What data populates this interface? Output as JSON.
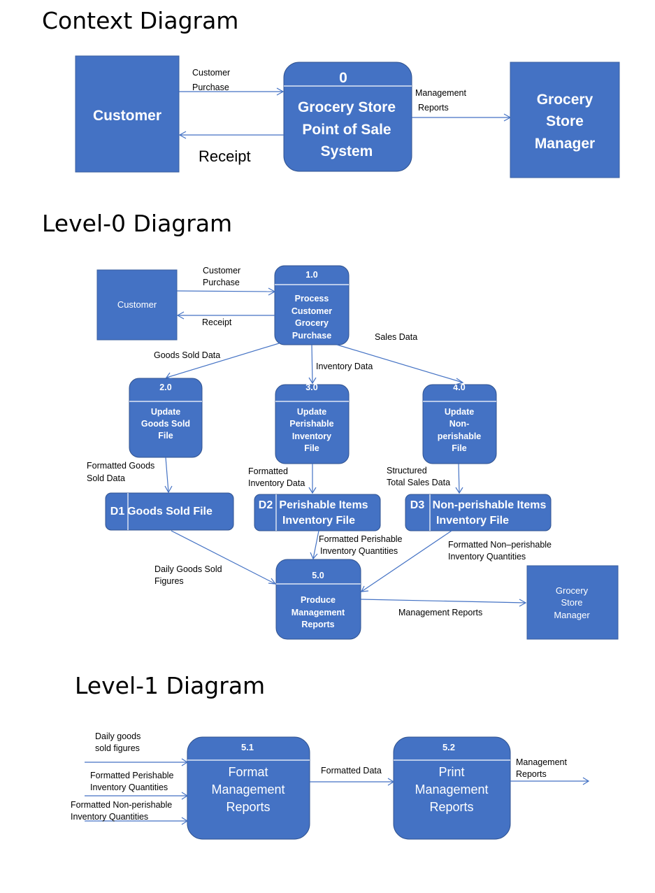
{
  "context": {
    "title": "Context Diagram",
    "customer": "Customer",
    "process_id": "0",
    "process_lines": [
      "Grocery Store",
      "Point of Sale",
      "System"
    ],
    "manager_lines": [
      "Grocery",
      "Store",
      "Manager"
    ],
    "flows": {
      "customer_purchase": [
        "Customer",
        "Purchase"
      ],
      "receipt": "Receipt",
      "management_reports": [
        "Management",
        "Reports"
      ]
    }
  },
  "level0": {
    "title": "Level-0 Diagram",
    "customer": "Customer",
    "manager_lines": [
      "Grocery",
      "Store",
      "Manager"
    ],
    "processes": [
      {
        "id": "1.0",
        "lines": [
          "Process",
          "Customer",
          "Grocery",
          "Purchase"
        ]
      },
      {
        "id": "2.0",
        "lines": [
          "Update",
          "Goods Sold",
          "File"
        ]
      },
      {
        "id": "3.0",
        "lines": [
          "Update",
          "Perishable",
          "Inventory",
          "File"
        ]
      },
      {
        "id": "4.0",
        "lines": [
          "Update",
          "Non-",
          "perishable",
          "File"
        ]
      },
      {
        "id": "5.0",
        "lines": [
          "Produce",
          "Management",
          "Reports"
        ]
      }
    ],
    "stores": [
      {
        "id": "D1",
        "lines": [
          "Goods  Sold File"
        ]
      },
      {
        "id": "D2",
        "lines": [
          "Perishable Items",
          "Inventory File"
        ]
      },
      {
        "id": "D3",
        "lines": [
          "Non-perishable Items",
          "Inventory File"
        ]
      }
    ],
    "flows": {
      "customer_purchase": [
        "Customer",
        "Purchase"
      ],
      "receipt": "Receipt",
      "goods_sold_data": "Goods Sold Data",
      "inventory_data": "Inventory Data",
      "sales_data": "Sales Data",
      "formatted_goods_sold": [
        "Formatted Goods",
        "Sold Data"
      ],
      "formatted_inventory": [
        "Formatted",
        "Inventory Data"
      ],
      "structured_total_sales": [
        "Structured",
        "Total Sales  Data"
      ],
      "daily_goods_sold": [
        "Daily Goods Sold",
        "Figures"
      ],
      "formatted_perishable_qty": [
        "Formatted Perishable",
        "Inventory  Quantities"
      ],
      "formatted_nonperishable_qty": [
        "Formatted Non–perishable",
        "Inventory Quantities"
      ],
      "management_reports": "Management Reports"
    }
  },
  "level1": {
    "title": "Level-1 Diagram",
    "processes": [
      {
        "id": "5.1",
        "lines": [
          "Format",
          "Management",
          "Reports"
        ]
      },
      {
        "id": "5.2",
        "lines": [
          "Print",
          "Management",
          "Reports"
        ]
      }
    ],
    "flows": {
      "daily_goods": [
        "Daily goods",
        "sold figures"
      ],
      "formatted_perishable": [
        "Formatted Perishable",
        "Inventory Quantities"
      ],
      "formatted_nonperishable": [
        "Formatted Non-perishable",
        "Inventory Quantities"
      ],
      "formatted_data": "Formatted Data",
      "management_reports": [
        "Management",
        "Reports"
      ]
    }
  }
}
